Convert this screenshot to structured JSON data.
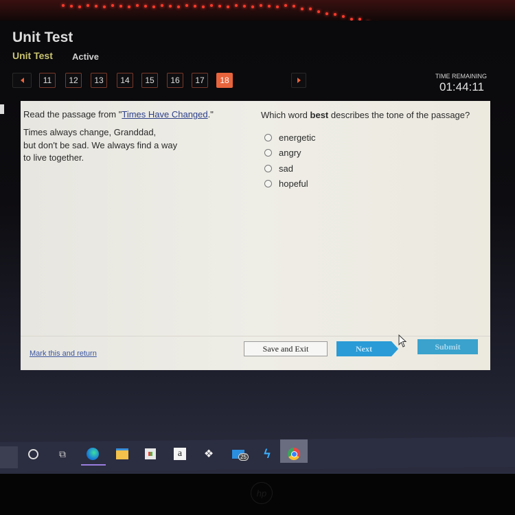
{
  "header": {
    "title": "Unit Test",
    "subtitle": "Unit Test",
    "status": "Active"
  },
  "pagination": {
    "prev_icon": "triangle-left",
    "next_icon": "triangle-right",
    "pages": [
      "11",
      "12",
      "13",
      "14",
      "15",
      "16",
      "17",
      "18"
    ],
    "current": "18"
  },
  "timer": {
    "label": "TIME REMAINING",
    "value": "01:44:11"
  },
  "question": {
    "prompt_prefix": "Read the passage from \"",
    "prompt_link": "Times Have Changed",
    "prompt_suffix": ".\"",
    "passage_lines": [
      "Times always change, Granddad,",
      "but don't be sad. We always find a way",
      "to live together."
    ],
    "stem_before": "Which word ",
    "stem_bold": "best",
    "stem_after": " describes the tone of the passage?",
    "options": [
      "energetic",
      "angry",
      "sad",
      "hopeful"
    ]
  },
  "footer": {
    "mark_link": "Mark this and return",
    "save_exit": "Save and Exit",
    "next": "Next",
    "submit": "Submit"
  },
  "taskbar": {
    "icons": [
      "cortana-icon",
      "task-view-icon",
      "edge-icon",
      "file-explorer-icon",
      "store-icon",
      "amazon-icon",
      "dropbox-icon",
      "mail-icon",
      "app-icon",
      "chrome-icon"
    ],
    "mail_badge": "25",
    "amazon_glyph": "a"
  },
  "colors": {
    "accent_orange": "#e8643c",
    "next_blue": "#2a9bd6",
    "submit_blue": "#3aa2cc",
    "link_blue": "#2c3f88"
  }
}
